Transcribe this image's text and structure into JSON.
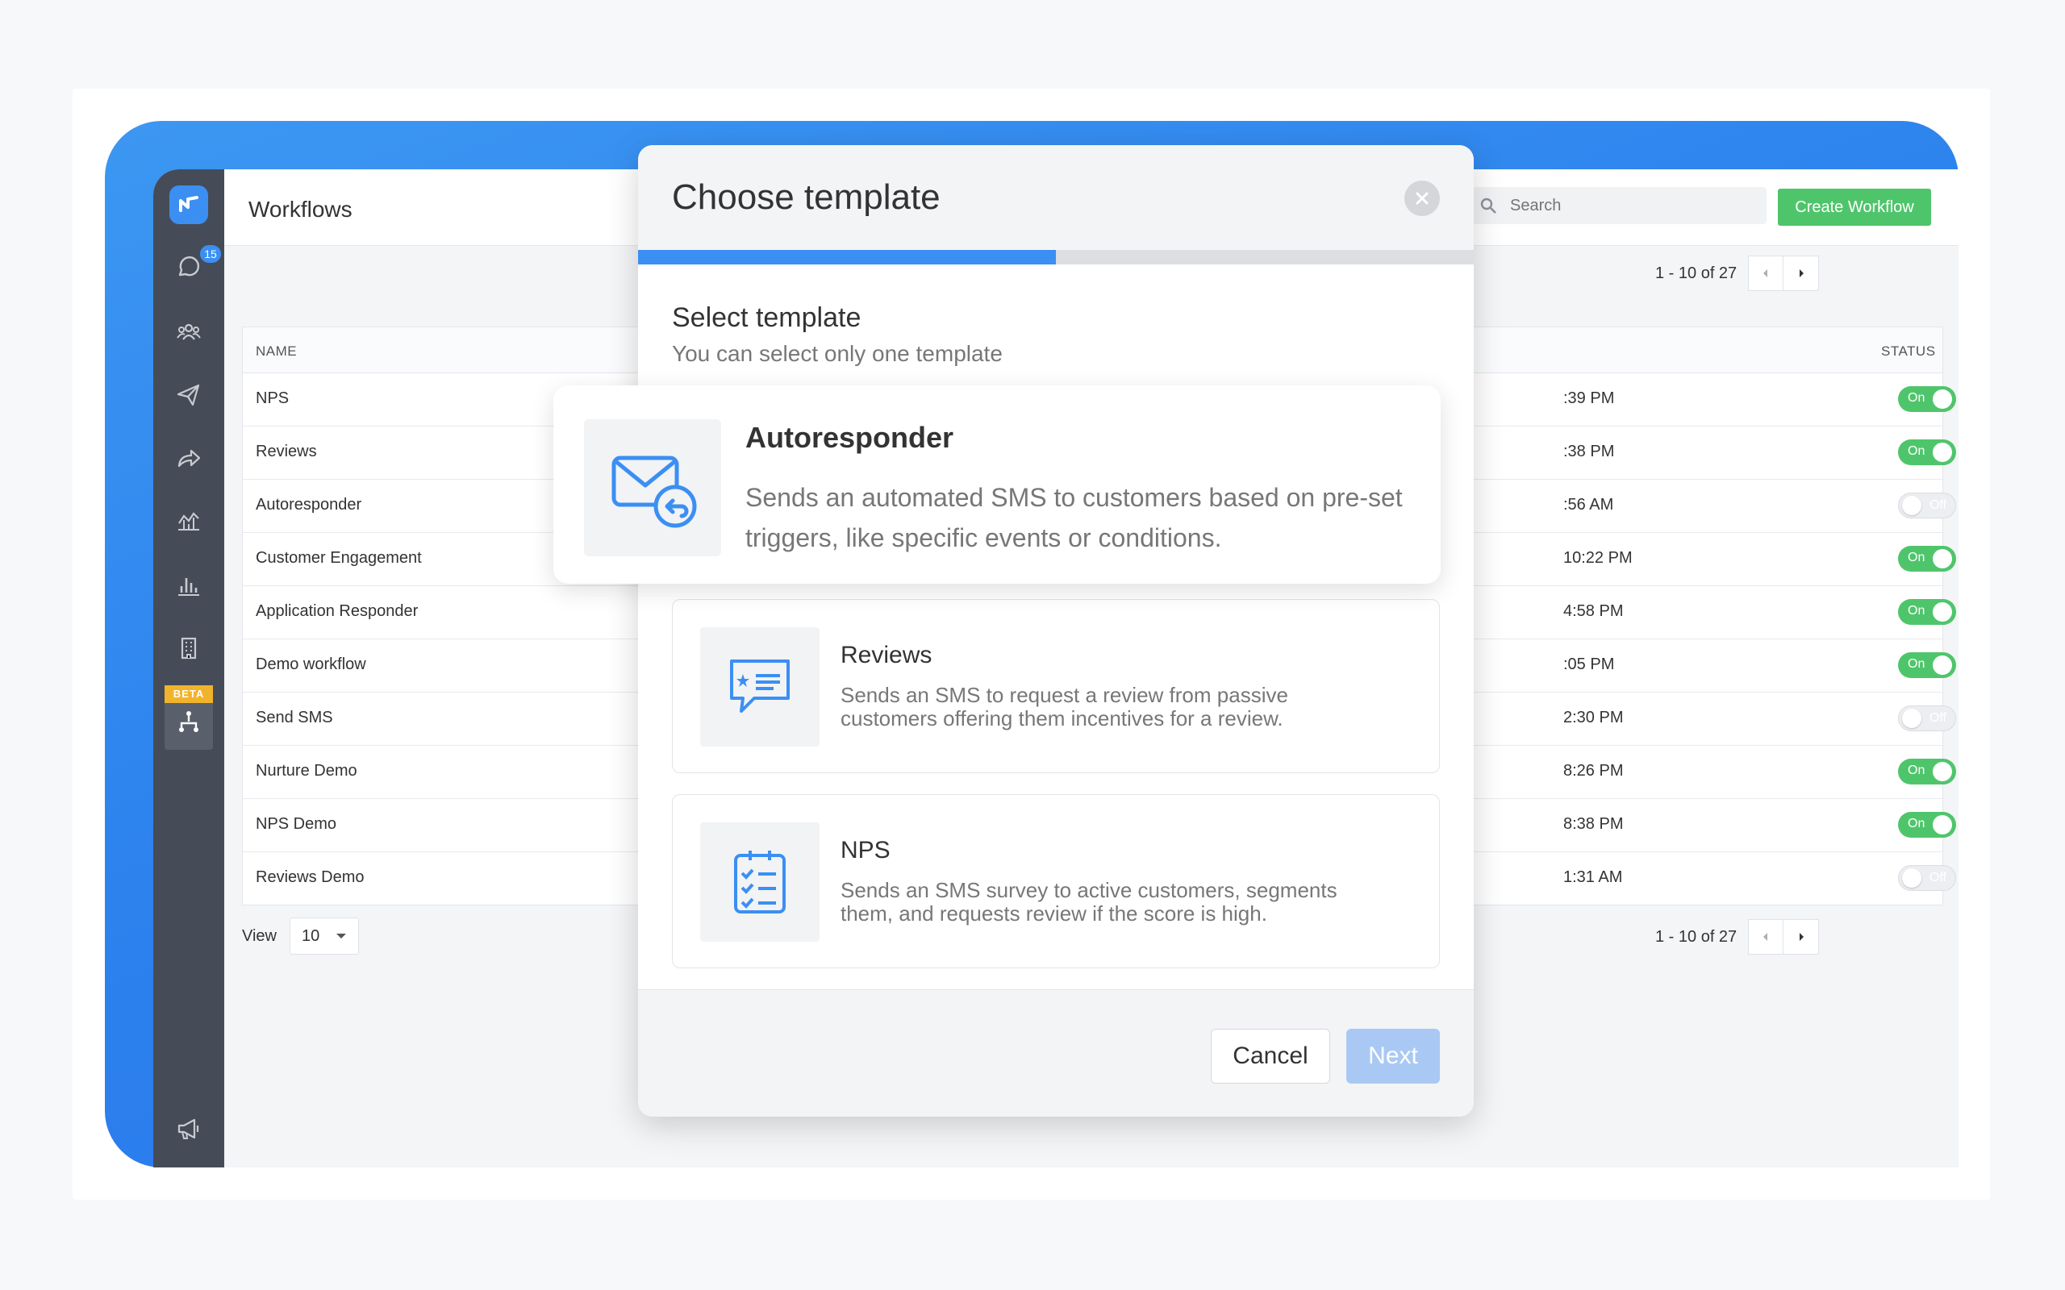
{
  "sidebar": {
    "messages_badge": "15",
    "beta_label": "BETA"
  },
  "header": {
    "title": "Workflows",
    "search_placeholder": "Search",
    "create_button": "Create Workflow"
  },
  "pagination": {
    "top": "1 - 10 of 27",
    "bottom": "1 - 10 of 27"
  },
  "table": {
    "columns": {
      "name": "NAME",
      "status": "STATUS"
    },
    "rows": [
      {
        "name": "NPS",
        "time": ":39 PM",
        "status": "On"
      },
      {
        "name": "Reviews",
        "time": ":38 PM",
        "status": "On"
      },
      {
        "name": "Autoresponder",
        "time": ":56 AM",
        "status": "Off"
      },
      {
        "name": "Customer Engagement",
        "time": "10:22 PM",
        "status": "On"
      },
      {
        "name": "Application Responder",
        "time": "4:58 PM",
        "status": "On"
      },
      {
        "name": "Demo workflow",
        "time": ":05 PM",
        "status": "On"
      },
      {
        "name": "Send SMS",
        "time": "2:30 PM",
        "status": "Off"
      },
      {
        "name": "Nurture Demo",
        "time": "8:26 PM",
        "status": "On"
      },
      {
        "name": "NPS Demo",
        "time": "8:38 PM",
        "status": "On"
      },
      {
        "name": "Reviews Demo",
        "time": "1:31 AM",
        "status": "Off"
      }
    ]
  },
  "view": {
    "label": "View",
    "value": "10"
  },
  "modal": {
    "title": "Choose template",
    "progress": 0.5,
    "section_title": "Select template",
    "section_subtitle": "You can select only one template",
    "templates": [
      {
        "name": "Autoresponder",
        "description": "Sends an automated SMS to customers based on pre-set triggers, like specific events or conditions.",
        "icon": "envelope-reply-icon"
      },
      {
        "name": "Reviews",
        "description": "Sends an SMS to request a review from passive customers offering them incentives for a review.",
        "icon": "review-chat-icon"
      },
      {
        "name": "NPS",
        "description": "Sends an SMS survey to active customers, segments them, and requests review if the score is high.",
        "icon": "checklist-icon"
      }
    ],
    "cancel_label": "Cancel",
    "next_label": "Next"
  },
  "colors": {
    "accent": "#3b8ff3",
    "success": "#4fc56b",
    "sidebar": "#454c57"
  }
}
